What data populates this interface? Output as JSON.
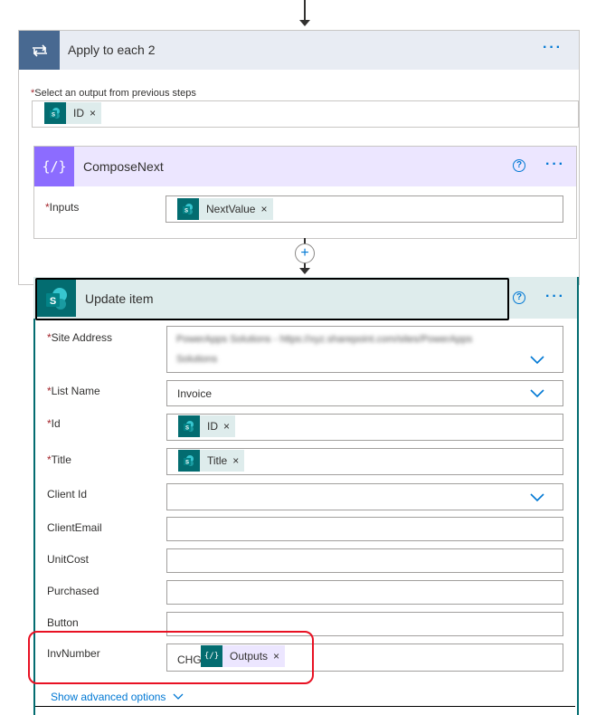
{
  "apply": {
    "title": "Apply to each 2",
    "more": "···",
    "select_label_req": "*",
    "select_label": "Select an output from previous steps",
    "select_token": "ID",
    "token_remove": "×"
  },
  "compose": {
    "title": "ComposeNext",
    "help": "?",
    "more": "···",
    "inputs_req": "*",
    "inputs_label": "Inputs",
    "inputs_token": "NextValue",
    "token_remove": "×"
  },
  "update": {
    "title": "Update item",
    "help": "?",
    "more": "···",
    "fields": {
      "site_address": {
        "req": "*",
        "label": "Site Address",
        "value_line1": "PowerApps Solutions - https://xyz.sharepoint.com/sites/PowerApps",
        "value_line2": "Solutions"
      },
      "list_name": {
        "req": "*",
        "label": "List Name",
        "value": "Invoice"
      },
      "id": {
        "req": "*",
        "label": "Id",
        "token": "ID"
      },
      "title": {
        "req": "*",
        "label": "Title",
        "token": "Title"
      },
      "client_id": {
        "label": "Client Id",
        "value": ""
      },
      "client_email": {
        "label": "ClientEmail",
        "value": ""
      },
      "unit_cost": {
        "label": "UnitCost",
        "value": ""
      },
      "purchased": {
        "label": "Purchased",
        "value": ""
      },
      "button": {
        "label": "Button",
        "value": ""
      },
      "inv_number": {
        "label": "InvNumber",
        "prefix": "CHG",
        "token": "Outputs"
      }
    },
    "token_remove": "×",
    "advanced_link": "Show advanced options"
  },
  "colors": {
    "sharepoint": "#036c70",
    "compose": "#8c6cff",
    "loop": "#486991",
    "accent": "#0078d4",
    "highlight": "#e81123"
  },
  "icons": {
    "loop": "loop-icon",
    "compose": "compose-braces-icon",
    "sharepoint": "sharepoint-icon",
    "add": "plus-circle-icon",
    "chevron": "chevron-down-icon"
  }
}
